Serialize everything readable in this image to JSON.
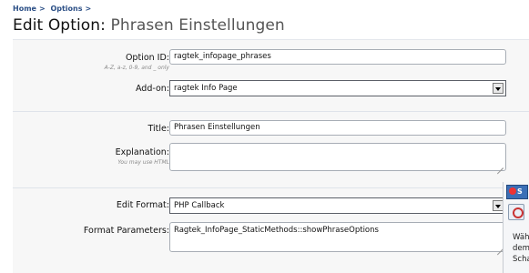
{
  "breadcrumb": [
    {
      "label": "Home",
      "sep": ">"
    },
    {
      "label": "Options",
      "sep": ">"
    }
  ],
  "page": {
    "title_prefix": "Edit Option:",
    "title_name": "Phrasen Einstellungen"
  },
  "form": {
    "option_id": {
      "label": "Option ID:",
      "hint": "A-Z, a-z, 0-9, and _ only",
      "value": "ragtek_infopage_phrases"
    },
    "addon": {
      "label": "Add-on:",
      "value": "ragtek Info Page"
    },
    "title": {
      "label": "Title:",
      "value": "Phrasen Einstellungen"
    },
    "explanation": {
      "label": "Explanation:",
      "hint": "You may use HTML",
      "value": ""
    },
    "edit_format": {
      "label": "Edit Format:",
      "value": "PHP Callback"
    },
    "format_parameters": {
      "label": "Format Parameters:",
      "value": "Ragtek_InfoPage_StaticMethods::showPhraseOptions"
    }
  },
  "taskbar": {
    "app_label": "S",
    "lines": [
      "Wäh",
      "dem",
      "Scha"
    ]
  }
}
